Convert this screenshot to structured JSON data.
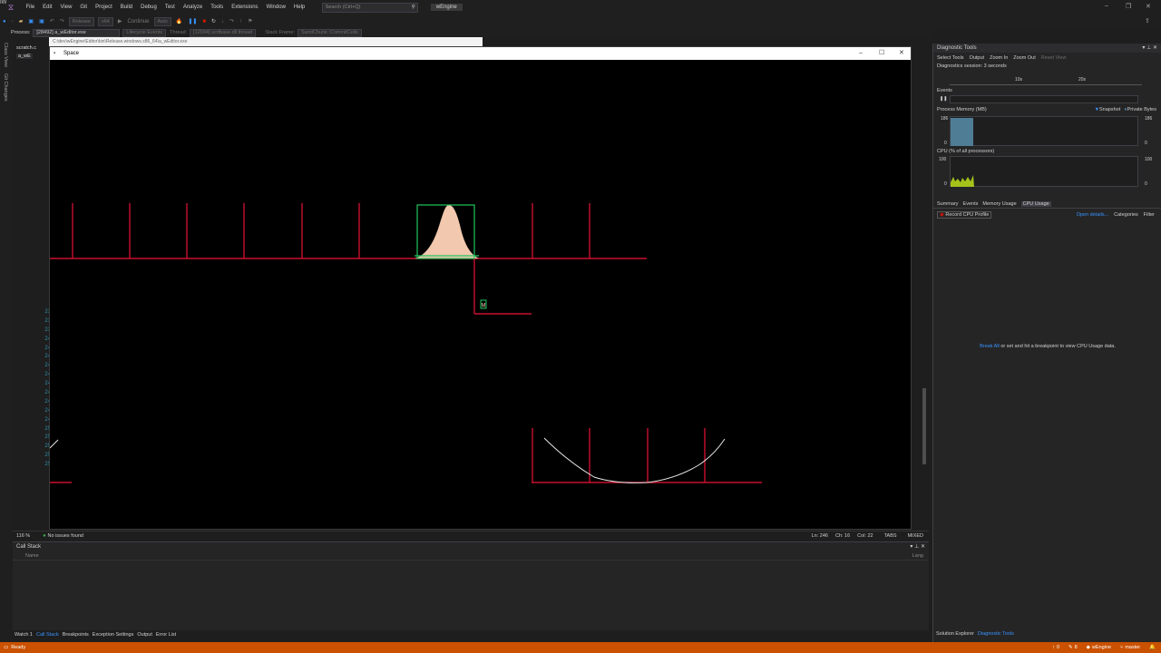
{
  "menu": {
    "items": [
      "File",
      "Edit",
      "View",
      "Git",
      "Project",
      "Build",
      "Debug",
      "Test",
      "Analyze",
      "Tools",
      "Extensions",
      "Window",
      "Help"
    ],
    "search_placeholder": "Search (Ctrl+Q)",
    "solution_name": "wEngine",
    "avatar": "IW"
  },
  "toolbar": {
    "config": "Release",
    "platform": "x64",
    "continue": "Continue",
    "auto": "Auto"
  },
  "procbar": {
    "process_label": "Process:",
    "process_value": "[28492] a_wEditor.exe",
    "lifecycle": "Lifecycle Events",
    "thread_label": "Thread:",
    "thread_value": "[12004] ucrtbase.dll thread",
    "stack_label": "Stack Frame:",
    "stack_value": "SandChunk::CommitCells"
  },
  "lefttabs": [
    "Class View",
    "Git Changes"
  ],
  "editor": {
    "tab_scratch": "scratch.c",
    "tab_file": "a_wE",
    "line_numbers": [
      "",
      "",
      "",
      "",
      "",
      "",
      "",
      "",
      "",
      "",
      "",
      "",
      "",
      "",
      "",
      "",
      "",
      "",
      "",
      "",
      "",
      "",
      "",
      "",
      "",
      "",
      "",
      "",
      "237",
      "238",
      "239",
      "240",
      "241",
      "242",
      "243",
      "244",
      "245",
      "246",
      "247",
      "248",
      "249",
      "250",
      "251",
      "252",
      "253",
      "254"
    ],
    "zoom": "116 %",
    "issues": "No issues found",
    "ln": "Ln: 246",
    "ch": "Ch: 16",
    "col": "Col: 22",
    "tabs": "TABS",
    "encoding": "MIXED"
  },
  "behind_window": {
    "path": "C:\\dev\\wEngine\\Editor\\bin\\Release.windows.x86_64\\a_wEditor.exe"
  },
  "space_window": {
    "title": "Space",
    "marker_label": "M"
  },
  "diagnostics": {
    "title": "Diagnostic Tools",
    "toolbar": [
      "Select Tools",
      "Output",
      "Zoom In",
      "Zoom Out",
      "Reset View"
    ],
    "session": "Diagnostics session: 3 seconds",
    "timeline_ticks": [
      "10s",
      "20s"
    ],
    "events_label": "Events",
    "memory_label": "Process Memory (MB)",
    "memory_legend": [
      "Snapshot",
      "Private Bytes"
    ],
    "memory_max": "186",
    "memory_min": "0",
    "cpu_label": "CPU (% of all processors)",
    "cpu_max": "100",
    "cpu_min": "0",
    "tabs": [
      "Summary",
      "Events",
      "Memory Usage",
      "CPU Usage"
    ],
    "record": "Record CPU Profile",
    "open_details": "Open details...",
    "categories": "Categories",
    "filter": "Filter",
    "hint_link": "Break All",
    "hint_text": " or set and hit a breakpoint to view CPU Usage data.",
    "bottom_tabs": [
      "Solution Explorer",
      "Diagnostic Tools"
    ]
  },
  "callstack": {
    "title": "Call Stack",
    "col_name": "Name",
    "col_lang": "Lang"
  },
  "bottom_tabs": [
    "Watch 1",
    "Call Stack",
    "Breakpoints",
    "Exception Settings",
    "Output",
    "Error List"
  ],
  "status": {
    "ready": "Ready",
    "up_count": "0",
    "pencil_count": "8",
    "repo": "wEngine",
    "branch": "master"
  },
  "colors": {
    "accent_purple": "#b180d7",
    "status_orange": "#ca5100",
    "sim_red": "#c8102e",
    "sim_green": "#22c55e",
    "sand_peach": "#f2c8ae",
    "cpu_green": "#a5c21a",
    "memory_blue": "#4e7d95",
    "link_blue": "#3794ff"
  }
}
